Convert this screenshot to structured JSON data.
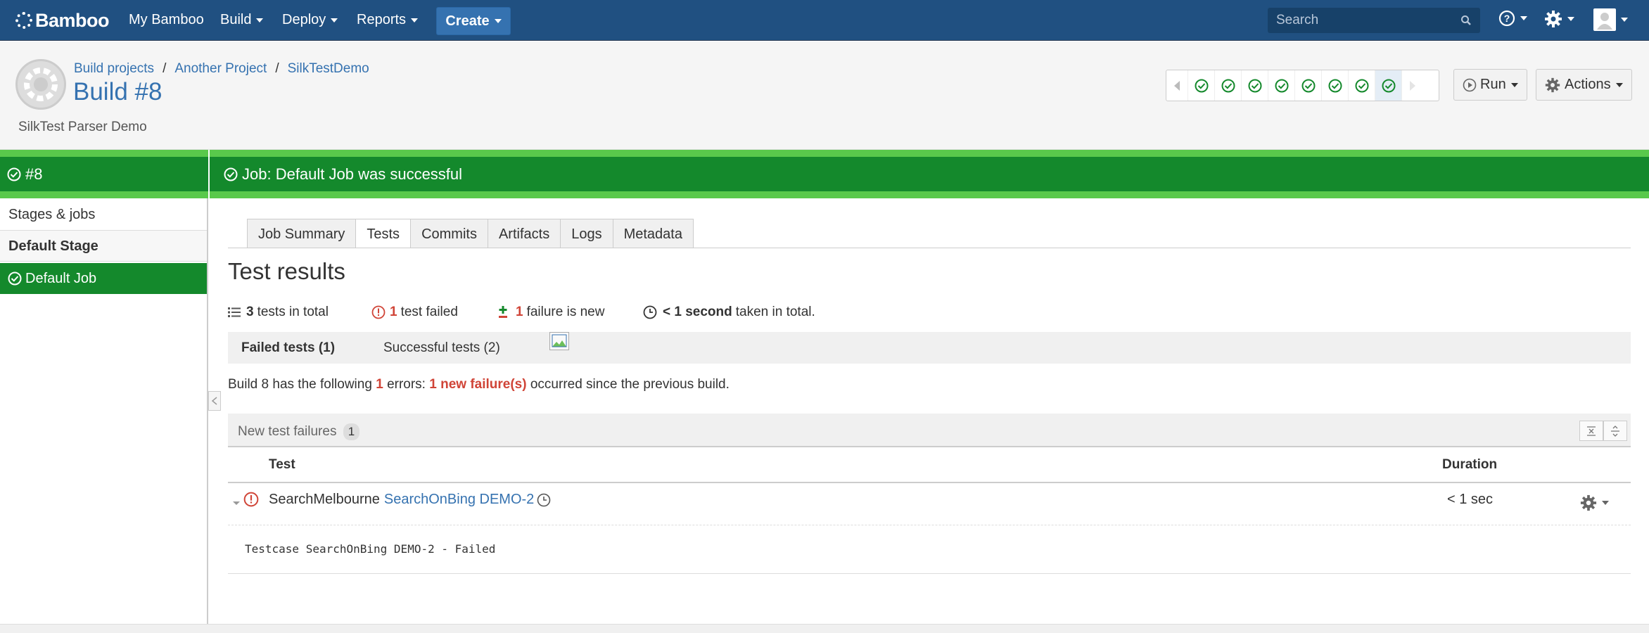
{
  "topnav": {
    "logo": "Bamboo",
    "items": [
      "My Bamboo",
      "Build",
      "Deploy",
      "Reports"
    ],
    "create_label": "Create",
    "search_placeholder": "Search"
  },
  "header": {
    "breadcrumbs": [
      "Build projects",
      "Another Project",
      "SilkTestDemo"
    ],
    "title": "Build #8",
    "subtitle": "SilkTest Parser Demo",
    "run_label": "Run",
    "actions_label": "Actions",
    "recent_builds": [
      "success",
      "success",
      "success",
      "success",
      "success",
      "success",
      "success",
      "success"
    ]
  },
  "status": {
    "build": "#8",
    "job": "Job: Default Job was successful",
    "color": "#14892c"
  },
  "sidebar": {
    "stages_link": "Stages & jobs",
    "stage": "Default Stage",
    "job": "Default Job"
  },
  "tabs": [
    "Job Summary",
    "Tests",
    "Commits",
    "Artifacts",
    "Logs",
    "Metadata"
  ],
  "results": {
    "title": "Test results",
    "total_count": "3",
    "total_text": "tests in total",
    "failed_count": "1",
    "failed_text": "test failed",
    "new_count": "1",
    "new_text": "failure is new",
    "time_bold": "< 1 second",
    "time_text": "taken in total."
  },
  "subtabs": {
    "failed": "Failed tests (1)",
    "successful": "Successful tests (2)"
  },
  "errors": {
    "prefix": "Build 8 has the following",
    "count": "1",
    "middle": "errors:",
    "new_failures": "1 new failure(s)",
    "suffix": "occurred since the previous build."
  },
  "failures": {
    "heading": "New test failures",
    "count": "1",
    "col_test": "Test",
    "col_duration": "Duration",
    "rows": [
      {
        "class": "SearchMelbourne",
        "test": "SearchOnBing DEMO-2",
        "duration": "< 1 sec",
        "log": "Testcase SearchOnBing DEMO-2 - Failed"
      }
    ]
  }
}
